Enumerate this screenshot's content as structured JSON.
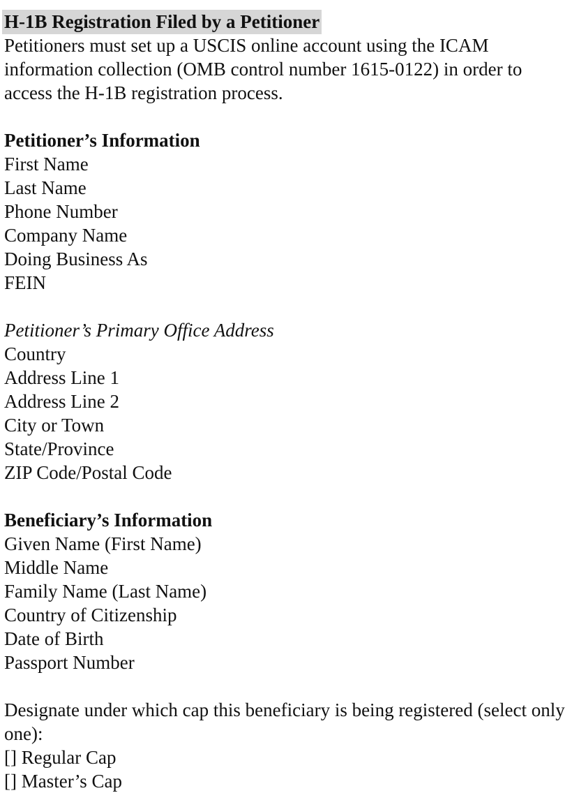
{
  "document": {
    "heading": "H-1B Registration Filed by a Petitioner",
    "heading_highlight_color": "#d6d6d6",
    "text_color": "#111111",
    "background_color": "#ffffff",
    "intro_paragraph": "Petitioners must set up a USCIS online account using the ICAM information collection (OMB control number 1615-0122) in order to access the H-1B registration process."
  },
  "petitioner_section": {
    "heading": "Petitioner’s Information",
    "fields": [
      "First Name",
      "Last Name",
      "Phone Number",
      "Company Name",
      "Doing Business As",
      "FEIN"
    ]
  },
  "petitioner_address_section": {
    "heading": "Petitioner’s Primary Office Address",
    "fields": [
      "Country",
      "Address Line 1",
      "Address Line 2",
      "City or Town",
      "State/Province",
      "ZIP Code/Postal Code"
    ]
  },
  "beneficiary_section": {
    "heading": "Beneficiary’s Information",
    "fields": [
      "Given Name (First Name)",
      "Middle Name",
      "Family Name (Last Name)",
      "Country of Citizenship",
      "Date of Birth",
      "Passport Number"
    ]
  },
  "cap_designation": {
    "prompt": "Designate under which cap this beneficiary is being registered (select only one):",
    "checkbox_glyph": "[]",
    "options": [
      "Regular Cap",
      "Master’s Cap"
    ]
  }
}
